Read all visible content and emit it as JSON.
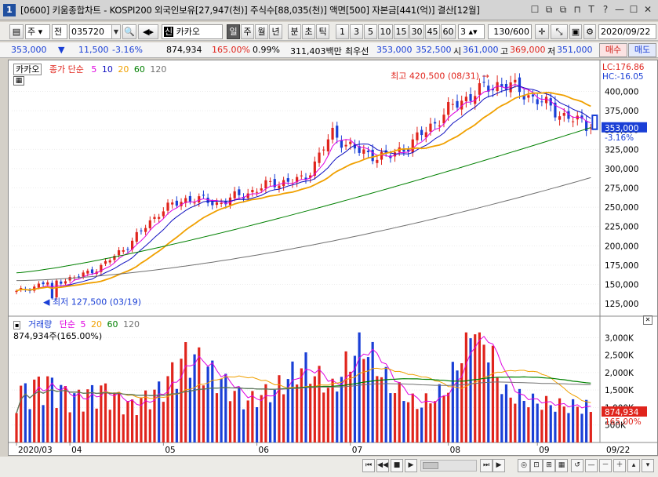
{
  "window": {
    "number": "1",
    "title": "[0600] 키움종합차트 - KOSPI200 외국인보유[27,947(천)] 주식수[88,035(천)] 액면[500] 자본금[441(억)] 결산[12월]",
    "controls": [
      "☐",
      "⧉",
      "⧉",
      "⊓",
      "T",
      "?",
      "—",
      "☐",
      "✕"
    ]
  },
  "toolbar": {
    "period_unit": "주",
    "market": "전",
    "code": "035720",
    "name": "카카오",
    "name_tag": "신",
    "periods": [
      "일",
      "주",
      "월",
      "년",
      "분",
      "초",
      "틱"
    ],
    "selected_period": "일",
    "intervals": [
      "1",
      "3",
      "5",
      "10",
      "15",
      "30",
      "45",
      "60"
    ],
    "interval_value": "3",
    "count": "130/600",
    "date": "2020/09/22"
  },
  "quote": {
    "price": "353,000",
    "change_arrow": "▼",
    "change": "11,500",
    "change_pct": "-3.16%",
    "volume": "874,934",
    "vol_ratio": "165.00%",
    "turnover": "0.99%",
    "amount": "311,403백만",
    "best_label": "최우선",
    "best_ask": "353,000",
    "best_bid": "352,500",
    "open_label": "시",
    "open": "361,000",
    "high_label": "고",
    "high": "369,000",
    "low_label": "저",
    "low": "351,000",
    "buy_btn": "매수",
    "sell_btn": "매도"
  },
  "price_chart": {
    "stock_tag": "카카오",
    "legend_title": "종가 단순",
    "ma_periods": [
      "5",
      "10",
      "20",
      "60",
      "120"
    ],
    "ma_colors": [
      "#e000e0",
      "#1010c0",
      "#f0a000",
      "#008000",
      "#707070"
    ],
    "lc": "LC:176.86",
    "hc": "HC:-16.05",
    "current_price": "353,000",
    "current_pct": "-3.16%",
    "high_note": "최고 420,500 (08/31)",
    "low_note": "최저 127,500 (03/19)",
    "y_ticks": [
      "400,000",
      "375,000",
      "350,000",
      "325,000",
      "300,000",
      "275,000",
      "250,000",
      "225,000",
      "200,000",
      "175,000",
      "150,000",
      "125,000"
    ]
  },
  "volume_chart": {
    "legend_title": "거래량",
    "legend_ma": "단순",
    "ma_periods": [
      "5",
      "20",
      "60",
      "120"
    ],
    "ma_colors": [
      "#e000e0",
      "#f0a000",
      "#008000",
      "#707070"
    ],
    "current_volume": "874,934주(165.00%)",
    "current_tag": "874,934",
    "current_pct_tag": "165.00%",
    "y_ticks": [
      "3,000K",
      "2,500K",
      "2,000K",
      "1,500K",
      "1,000K",
      "500K"
    ]
  },
  "x_axis": {
    "labels": [
      "2020/03",
      "04",
      "05",
      "06",
      "07",
      "08",
      "09"
    ],
    "end_date": "09/22"
  },
  "colors": {
    "up": "#e0241c",
    "down": "#1a3fd6",
    "ma5": "#e000e0",
    "ma10": "#1010c0",
    "ma20": "#f0a000",
    "ma60": "#008000",
    "ma120": "#707070"
  },
  "chart_data": [
    {
      "type": "candlestick",
      "title": "카카오",
      "ylabel": "",
      "x": [
        "2020/03",
        "04",
        "05",
        "06",
        "07",
        "08",
        "09"
      ],
      "ylim": [
        115000,
        430000
      ],
      "series": [
        {
          "name": "종가",
          "values": [
            140000,
            152000,
            158000,
            174000,
            205000,
            245000,
            262000,
            255000,
            268000,
            282000,
            285000,
            345000,
            320000,
            315000,
            340000,
            375000,
            400000,
            410000,
            392000,
            370000,
            353000
          ]
        }
      ],
      "annotations": [
        {
          "text": "최고 420,500 (08/31)",
          "value": 420500
        },
        {
          "text": "최저 127,500 (03/19)",
          "value": 127500
        }
      ]
    },
    {
      "type": "bar",
      "title": "거래량",
      "ylabel": "",
      "ylim": [
        0,
        3300000
      ],
      "series": [
        {
          "name": "거래량",
          "values": [
            1200000,
            1500000,
            1100000,
            1300000,
            900000,
            1300000,
            2200000,
            1600000,
            1000000,
            1300000,
            1900000,
            1300000,
            2500000,
            1400000,
            900000,
            1300000,
            3100000,
            1200000,
            1000000,
            900000,
            874934
          ]
        }
      ]
    }
  ]
}
